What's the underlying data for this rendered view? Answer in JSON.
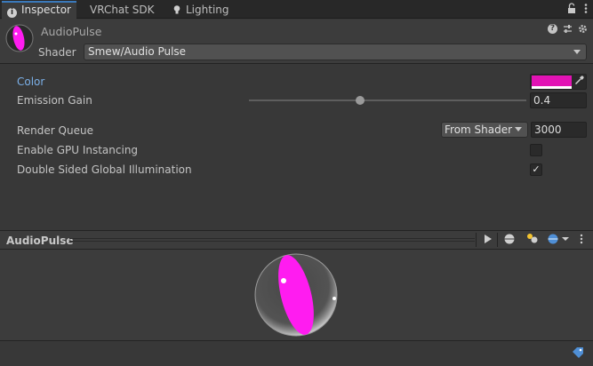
{
  "tabs": [
    {
      "label": "Inspector",
      "icon": "info-icon",
      "active": true
    },
    {
      "label": "VRChat SDK",
      "icon": "",
      "active": false
    },
    {
      "label": "Lighting",
      "icon": "lightbulb-icon",
      "active": false
    }
  ],
  "tab_icons": {
    "lock": "lock-icon",
    "menu": "kebab-menu-icon"
  },
  "header": {
    "material_name": "AudioPulse",
    "shader_label": "Shader",
    "shader_value": "Smew/Audio Pulse",
    "icons": [
      "help-icon",
      "preset-icon",
      "settings-icon"
    ]
  },
  "properties": {
    "color": {
      "label": "Color",
      "value": "#E213B4"
    },
    "emission_gain": {
      "label": "Emission Gain",
      "value": "0.4",
      "slider_fraction": 0.4
    },
    "render_queue": {
      "label": "Render Queue",
      "dropdown": "From Shader",
      "value": "3000"
    },
    "gpu_instancing": {
      "label": "Enable GPU Instancing",
      "checked": false
    },
    "double_sided_gi": {
      "label": "Double Sided Global Illumination",
      "checked": true,
      "check_glyph": "✓"
    }
  },
  "preview": {
    "title": "AudioPulse",
    "tools": [
      "play-icon",
      "sphere-shape-icon",
      "light-icon",
      "environment-icon",
      "menu-icon"
    ]
  },
  "colors": {
    "accent": "#3A79BB",
    "highlight_label": "#7BB0E8",
    "sphere_magenta": "#FF1CF0",
    "panel": "#383838"
  }
}
